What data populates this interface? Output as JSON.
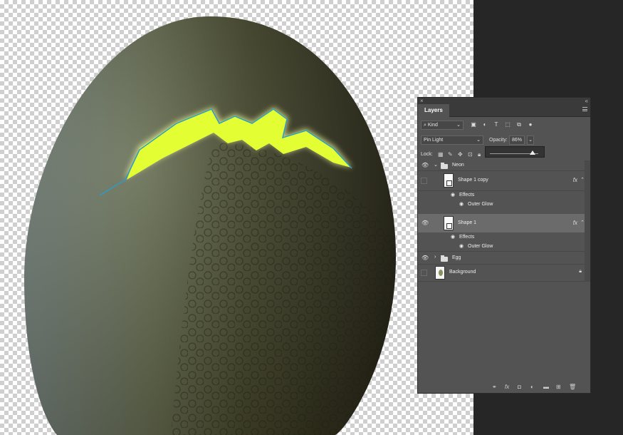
{
  "panel": {
    "title": "Layers",
    "filter_kind": "Kind",
    "blend_mode": "Pin Light",
    "opacity_label": "Opacity:",
    "opacity_value": "86%",
    "opacity_slider_fraction": 0.86,
    "lock_label": "Lock:",
    "layers": [
      {
        "name": "Neon",
        "type": "group",
        "expanded": true,
        "visible": true
      },
      {
        "name": "Shape 1 copy",
        "type": "shape",
        "visible": false,
        "fx": "fx"
      },
      {
        "name": "Effects",
        "type": "effects"
      },
      {
        "name": "Outer Glow",
        "type": "effect"
      },
      {
        "name": "Shape 1",
        "type": "shape",
        "visible": true,
        "selected": true,
        "fx": "fx"
      },
      {
        "name": "Effects",
        "type": "effects"
      },
      {
        "name": "Outer Glow",
        "type": "effect"
      },
      {
        "name": "Egg",
        "type": "group",
        "expanded": false,
        "visible": true
      },
      {
        "name": "Background",
        "type": "background",
        "visible": false,
        "locked": true
      }
    ]
  },
  "colors": {
    "panel_bg": "#535353",
    "selected_row": "#6b6b6b",
    "neon": "#e3ff33",
    "glow": "#f4ffa0"
  }
}
